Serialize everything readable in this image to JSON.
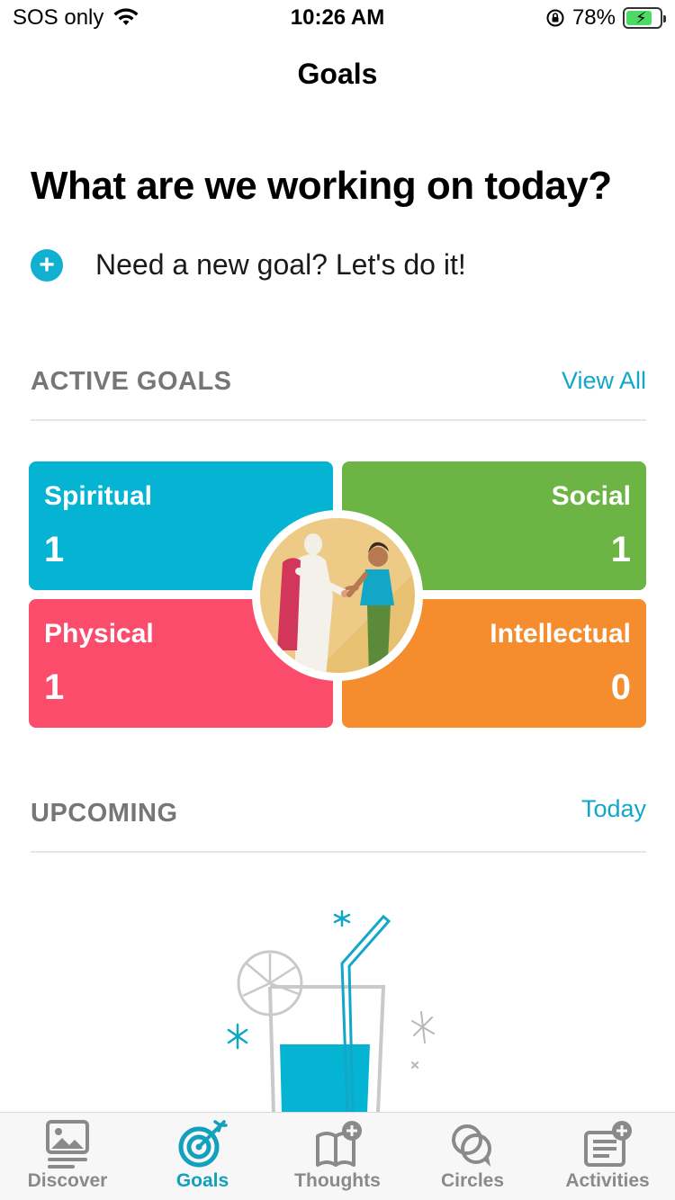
{
  "status_bar": {
    "carrier": "SOS only",
    "time": "10:26 AM",
    "battery_percent": "78%",
    "battery_level": 0.78,
    "icons": [
      "wifi-icon",
      "rotation-lock-icon",
      "battery-charging-icon"
    ]
  },
  "nav": {
    "title": "Goals"
  },
  "headline": "What are we working on today?",
  "new_goal": {
    "label": "Need a new goal? Let's do it!",
    "icon": "plus-circle-icon"
  },
  "active_goals": {
    "title": "ACTIVE GOALS",
    "link": "View All",
    "tiles": [
      {
        "label": "Spiritual",
        "count": "1",
        "color": "#05b4d2"
      },
      {
        "label": "Social",
        "count": "1",
        "color": "#6cb443"
      },
      {
        "label": "Physical",
        "count": "1",
        "color": "#fb4c6c"
      },
      {
        "label": "Intellectual",
        "count": "0",
        "color": "#f58c2d"
      }
    ]
  },
  "upcoming": {
    "title": "UPCOMING",
    "link": "Today"
  },
  "tab_bar": {
    "items": [
      {
        "label": "Discover",
        "icon": "image-icon",
        "active": false
      },
      {
        "label": "Goals",
        "icon": "target-arrow-icon",
        "active": true
      },
      {
        "label": "Thoughts",
        "icon": "journal-add-icon",
        "active": false
      },
      {
        "label": "Circles",
        "icon": "chat-bubbles-icon",
        "active": false
      },
      {
        "label": "Activities",
        "icon": "list-add-icon",
        "active": false
      }
    ]
  },
  "colors": {
    "accent": "#12a7c7",
    "muted_heading": "#767676"
  }
}
